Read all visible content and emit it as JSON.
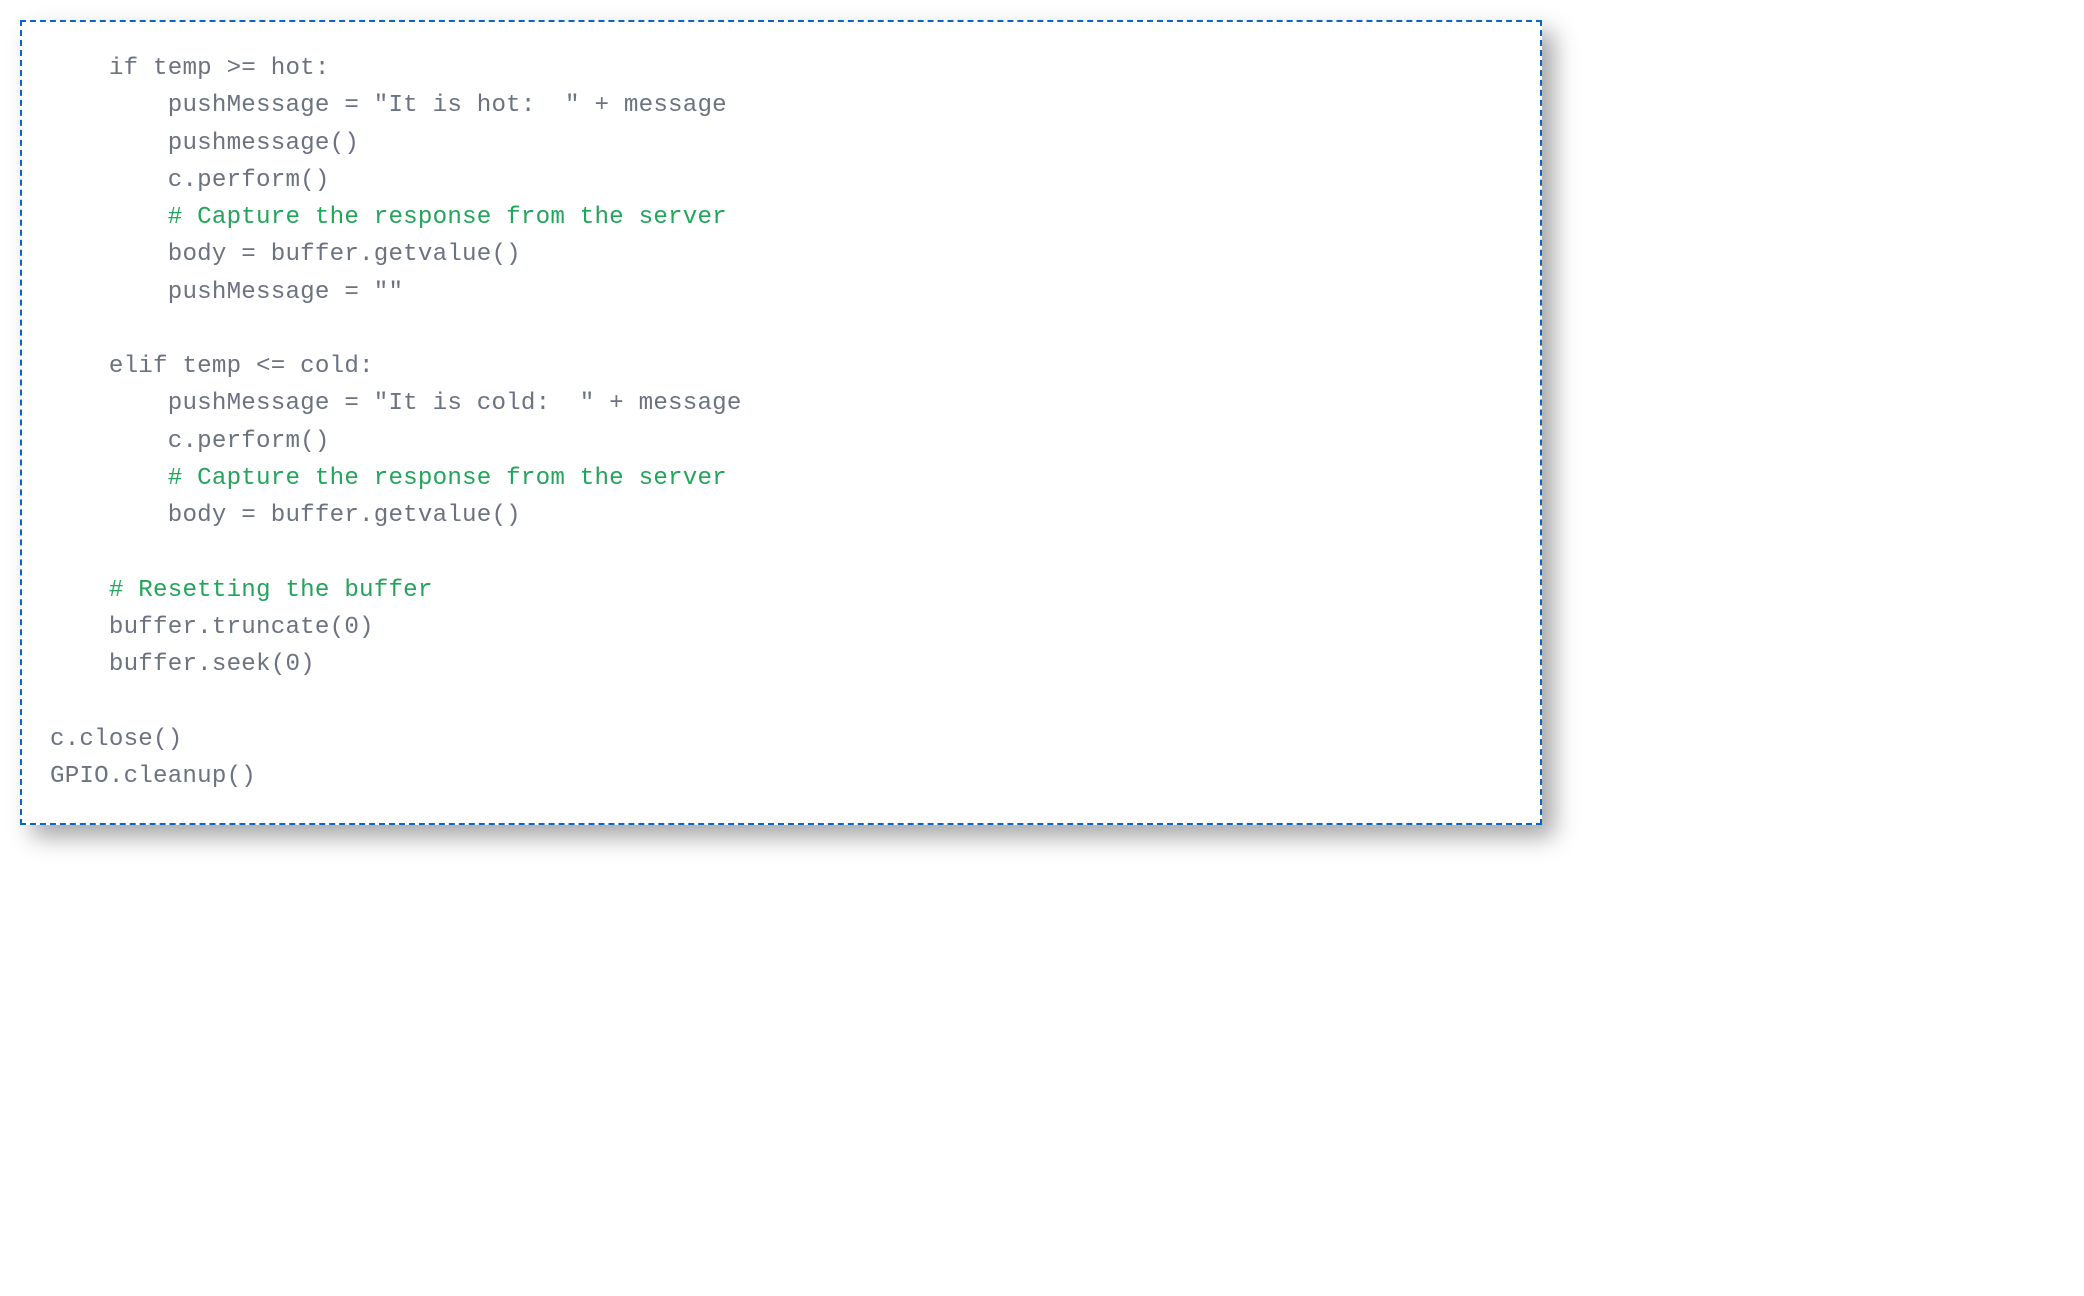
{
  "lines": [
    {
      "indent": 4,
      "segments": [
        {
          "cls": "code",
          "text": "if temp >= hot:"
        }
      ]
    },
    {
      "indent": 8,
      "segments": [
        {
          "cls": "code",
          "text": "pushMessage = \"It is hot:  \" + message"
        }
      ]
    },
    {
      "indent": 8,
      "segments": [
        {
          "cls": "code",
          "text": "pushmessage()"
        }
      ]
    },
    {
      "indent": 8,
      "segments": [
        {
          "cls": "code",
          "text": "c.perform()"
        }
      ]
    },
    {
      "indent": 8,
      "segments": [
        {
          "cls": "comment",
          "text": "# Capture the response from the server"
        }
      ]
    },
    {
      "indent": 8,
      "segments": [
        {
          "cls": "code",
          "text": "body = buffer.getvalue()"
        }
      ]
    },
    {
      "indent": 8,
      "segments": [
        {
          "cls": "code",
          "text": "pushMessage = \"\""
        }
      ]
    },
    {
      "indent": 0,
      "segments": [
        {
          "cls": "code",
          "text": ""
        }
      ]
    },
    {
      "indent": 4,
      "segments": [
        {
          "cls": "code",
          "text": "elif temp <= cold:"
        }
      ]
    },
    {
      "indent": 8,
      "segments": [
        {
          "cls": "code",
          "text": "pushMessage = \"It is cold:  \" + message"
        }
      ]
    },
    {
      "indent": 8,
      "segments": [
        {
          "cls": "code",
          "text": "c.perform()"
        }
      ]
    },
    {
      "indent": 8,
      "segments": [
        {
          "cls": "comment",
          "text": "# Capture the response from the server"
        }
      ]
    },
    {
      "indent": 8,
      "segments": [
        {
          "cls": "code",
          "text": "body = buffer.getvalue()"
        }
      ]
    },
    {
      "indent": 0,
      "segments": [
        {
          "cls": "code",
          "text": ""
        }
      ]
    },
    {
      "indent": 4,
      "segments": [
        {
          "cls": "comment",
          "text": "# Resetting the buffer"
        }
      ]
    },
    {
      "indent": 4,
      "segments": [
        {
          "cls": "code",
          "text": "buffer.truncate(0)"
        }
      ]
    },
    {
      "indent": 4,
      "segments": [
        {
          "cls": "code",
          "text": "buffer.seek(0)"
        }
      ]
    },
    {
      "indent": 0,
      "segments": [
        {
          "cls": "code",
          "text": ""
        }
      ]
    },
    {
      "indent": 0,
      "segments": [
        {
          "cls": "code",
          "text": "c.close()"
        }
      ]
    },
    {
      "indent": 0,
      "segments": [
        {
          "cls": "code",
          "text": "GPIO.cleanup()"
        }
      ]
    }
  ]
}
